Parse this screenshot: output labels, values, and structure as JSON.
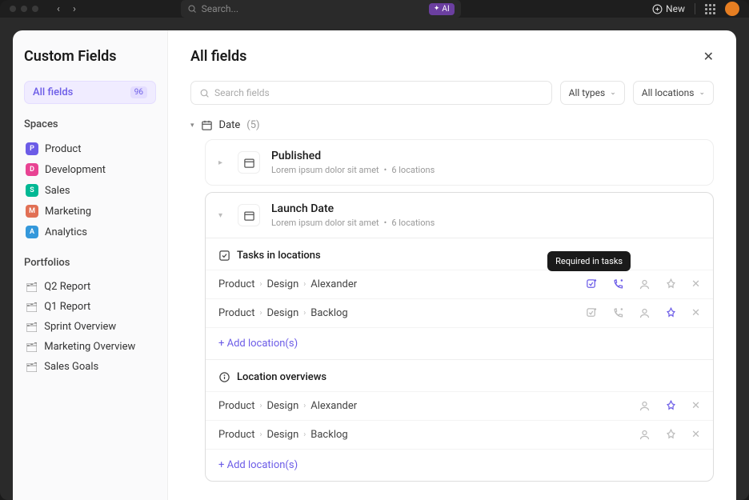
{
  "topbar": {
    "search_placeholder": "Search...",
    "ai_label": "AI",
    "new_label": "New"
  },
  "sidebar": {
    "title": "Custom Fields",
    "all_fields": {
      "label": "All fields",
      "count": "96"
    },
    "spaces_header": "Spaces",
    "spaces": [
      {
        "badge": "P",
        "label": "Product"
      },
      {
        "badge": "D",
        "label": "Development"
      },
      {
        "badge": "S",
        "label": "Sales"
      },
      {
        "badge": "M",
        "label": "Marketing"
      },
      {
        "badge": "A",
        "label": "Analytics"
      }
    ],
    "portfolios_header": "Portfolios",
    "portfolios": [
      {
        "label": "Q2 Report"
      },
      {
        "label": "Q1 Report"
      },
      {
        "label": "Sprint Overview"
      },
      {
        "label": "Marketing Overview"
      },
      {
        "label": "Sales Goals"
      }
    ]
  },
  "content": {
    "title": "All fields",
    "search_placeholder": "Search fields",
    "type_filter": "All types",
    "location_filter": "All locations",
    "group": {
      "label": "Date",
      "count": "(5)"
    },
    "fields": [
      {
        "name": "Published",
        "desc": "Lorem ipsum dolor sit amet",
        "loc": "6 locations"
      },
      {
        "name": "Launch Date",
        "desc": "Lorem ipsum dolor sit amet",
        "loc": "6 locations"
      }
    ],
    "tasks_section": "Tasks in locations",
    "tooltip": "Required in tasks",
    "task_rows": [
      {
        "crumbs": [
          "Product",
          "Design",
          "Alexander"
        ]
      },
      {
        "crumbs": [
          "Product",
          "Design",
          "Backlog"
        ]
      }
    ],
    "add_location": "+ Add location(s)",
    "overview_section": "Location overviews",
    "overview_rows": [
      {
        "crumbs": [
          "Product",
          "Design",
          "Alexander"
        ]
      },
      {
        "crumbs": [
          "Product",
          "Design",
          "Backlog"
        ]
      }
    ]
  }
}
